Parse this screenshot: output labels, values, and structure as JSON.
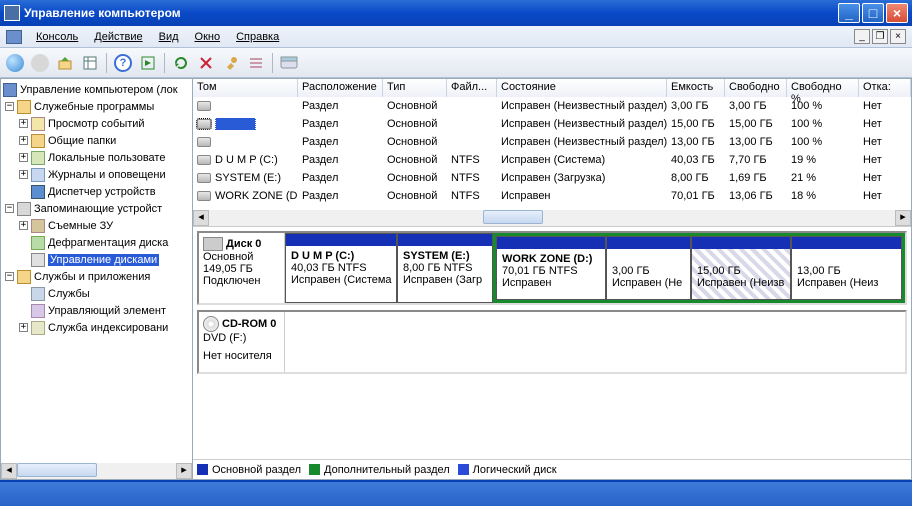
{
  "window": {
    "title": "Управление компьютером",
    "menus": [
      "Консоль",
      "Действие",
      "Вид",
      "Окно",
      "Справка"
    ]
  },
  "tree": {
    "root": "Управление компьютером (лок",
    "group1": "Служебные программы",
    "g1items": [
      "Просмотр событий",
      "Общие папки",
      "Локальные пользовате",
      "Журналы и оповещени",
      "Диспетчер устройств"
    ],
    "group2": "Запоминающие устройст",
    "g2items": [
      "Съемные ЗУ",
      "Дефрагментация диска",
      "Управление дисками"
    ],
    "group3": "Службы и приложения",
    "g3items": [
      "Службы",
      "Управляющий элемент",
      "Служба индексировани"
    ]
  },
  "columns": {
    "tom": "Том",
    "rasp": "Расположение",
    "tip": "Тип",
    "fs": "Файл...",
    "state": "Состояние",
    "cap": "Емкость",
    "free": "Свободно",
    "freepct": "Свободно %",
    "fault": "Отка:"
  },
  "volumes": [
    {
      "name": "",
      "loc": "Раздел",
      "type": "Основной",
      "fs": "",
      "state": "Исправен (Неизвестный раздел)",
      "cap": "3,00 ГБ",
      "free": "3,00 ГБ",
      "pct": "100 %",
      "fault": "Нет",
      "selected": false
    },
    {
      "name": "",
      "loc": "Раздел",
      "type": "Основной",
      "fs": "",
      "state": "Исправен (Неизвестный раздел)",
      "cap": "15,00 ГБ",
      "free": "15,00 ГБ",
      "pct": "100 %",
      "fault": "Нет",
      "selected": true
    },
    {
      "name": "",
      "loc": "Раздел",
      "type": "Основной",
      "fs": "",
      "state": "Исправен (Неизвестный раздел)",
      "cap": "13,00 ГБ",
      "free": "13,00 ГБ",
      "pct": "100 %",
      "fault": "Нет",
      "selected": false
    },
    {
      "name": "D U M P (C:)",
      "loc": "Раздел",
      "type": "Основной",
      "fs": "NTFS",
      "state": "Исправен (Система)",
      "cap": "40,03 ГБ",
      "free": "7,70 ГБ",
      "pct": "19 %",
      "fault": "Нет",
      "selected": false
    },
    {
      "name": "SYSTEM (E:)",
      "loc": "Раздел",
      "type": "Основной",
      "fs": "NTFS",
      "state": "Исправен (Загрузка)",
      "cap": "8,00 ГБ",
      "free": "1,69 ГБ",
      "pct": "21 %",
      "fault": "Нет",
      "selected": false
    },
    {
      "name": "WORK ZONE (D:)",
      "loc": "Раздел",
      "type": "Основной",
      "fs": "NTFS",
      "state": "Исправен",
      "cap": "70,01 ГБ",
      "free": "13,06 ГБ",
      "pct": "18 %",
      "fault": "Нет",
      "selected": false
    }
  ],
  "disk0": {
    "title": "Диск 0",
    "type": "Основной",
    "size": "149,05 ГБ",
    "status": "Подключен",
    "parts": [
      {
        "name": "D U M P  (C:)",
        "sub": "40,03 ГБ NTFS",
        "state": "Исправен (Система"
      },
      {
        "name": "SYSTEM  (E:)",
        "sub": "8,00 ГБ NTFS",
        "state": "Исправен (Загр"
      }
    ],
    "extparts": [
      {
        "name": "WORK ZONE  (D:)",
        "sub": "70,01 ГБ NTFS",
        "state": "Исправен"
      },
      {
        "name": "",
        "sub": "3,00 ГБ",
        "state": "Исправен (Не"
      },
      {
        "name": "",
        "sub": "15,00 ГБ",
        "state": "Исправен (Неизв",
        "hatched": true
      },
      {
        "name": "",
        "sub": "13,00 ГБ",
        "state": "Исправен (Неиз"
      }
    ]
  },
  "cdrom": {
    "title": "CD-ROM 0",
    "sub": "DVD (F:)",
    "status": "Нет носителя"
  },
  "legend": {
    "l1": "Основной раздел",
    "l2": "Дополнительный раздел",
    "l3": "Логический диск"
  }
}
